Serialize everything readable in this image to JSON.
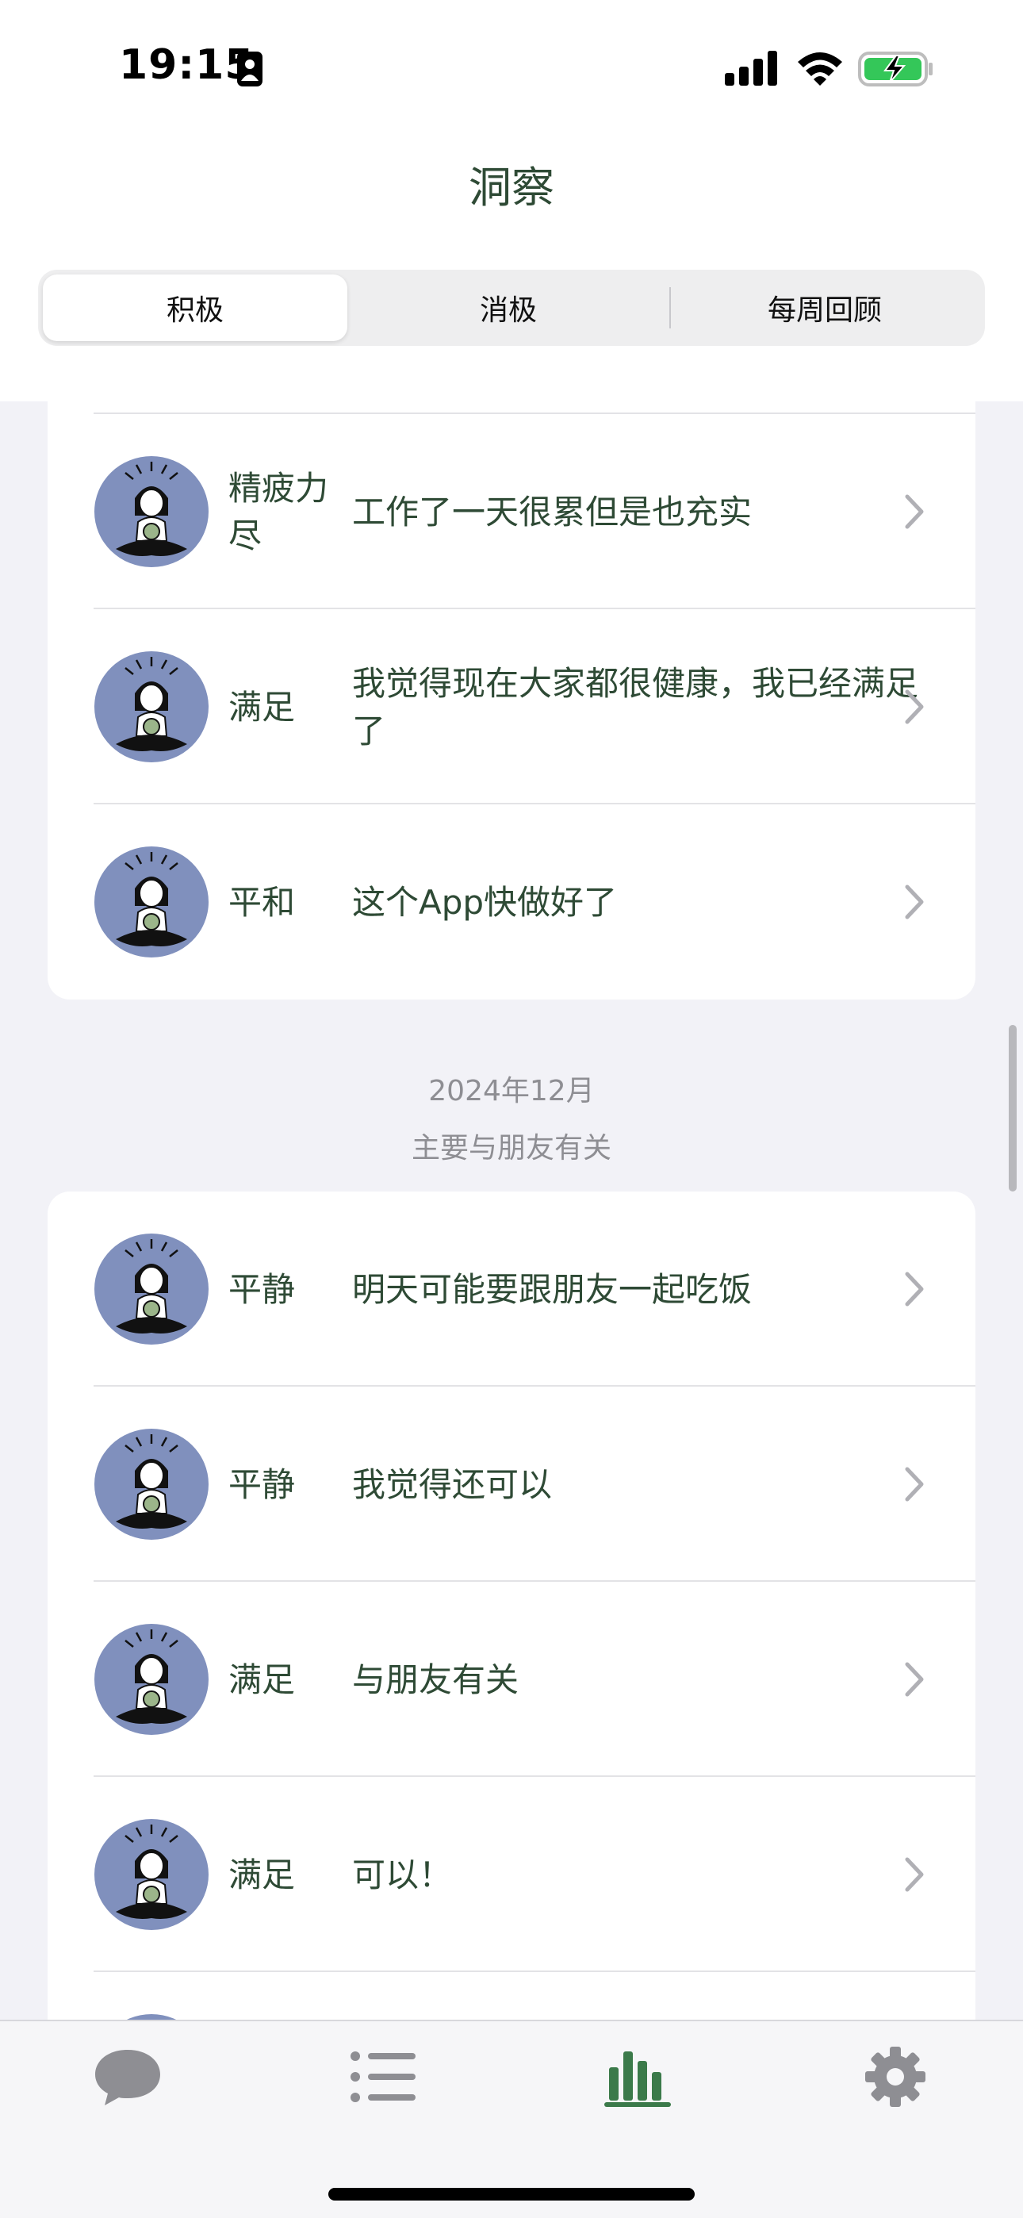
{
  "status_bar": {
    "time": "19:15"
  },
  "header": {
    "title": "洞察"
  },
  "segments": [
    "积极",
    "消极",
    "每周回顾"
  ],
  "colors": {
    "accent": "#3b7a4a",
    "text": "#2e4a35",
    "avatar_bg": "#8090bd",
    "background": "#f2f2f7"
  },
  "section_top": {
    "rows": [
      {
        "mood": "精疲力尽",
        "note": "工作了一天很累但是也充实"
      },
      {
        "mood": "满足",
        "note": "我觉得现在大家都很健康，我已经满足了"
      },
      {
        "mood": "平和",
        "note": "这个App快做好了"
      }
    ]
  },
  "section_dec": {
    "date": "2024年12月",
    "summary": "主要与朋友有关",
    "rows": [
      {
        "mood": "平静",
        "note": "明天可能要跟朋友一起吃饭"
      },
      {
        "mood": "平静",
        "note": "我觉得还可以"
      },
      {
        "mood": "满足",
        "note": "与朋友有关"
      },
      {
        "mood": "满足",
        "note": "可以！"
      }
    ]
  },
  "tabbar": {
    "tabs": [
      {
        "icon": "chat-bubble-icon",
        "active": false
      },
      {
        "icon": "list-icon",
        "active": false
      },
      {
        "icon": "bar-chart-icon",
        "active": true
      },
      {
        "icon": "gear-icon",
        "active": false
      }
    ]
  }
}
